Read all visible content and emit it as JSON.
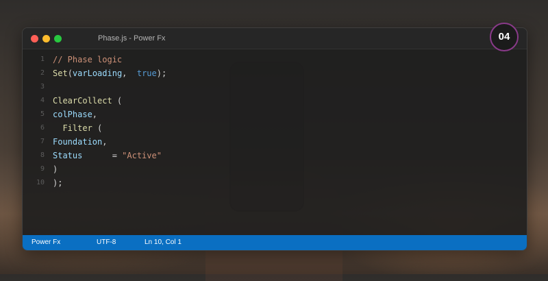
{
  "window": {
    "title": "Phase.js - Power Fx",
    "badge": "04"
  },
  "editor": {
    "lines": [
      {
        "n": "1",
        "tokens": [
          {
            "t": "// Phase logic",
            "c": "cmt"
          }
        ]
      },
      {
        "n": "2",
        "tokens": [
          {
            "t": "Set",
            "c": "fn"
          },
          {
            "t": "(",
            "c": "pun"
          },
          {
            "t": "varLoading",
            "c": "var"
          },
          {
            "t": ",  ",
            "c": "pun"
          },
          {
            "t": "true",
            "c": "kw"
          },
          {
            "t": ");",
            "c": "pun"
          }
        ]
      },
      {
        "n": "3",
        "tokens": []
      },
      {
        "n": "4",
        "tokens": [
          {
            "t": "ClearCollect",
            "c": "fn"
          },
          {
            "t": " (",
            "c": "pun"
          }
        ]
      },
      {
        "n": "5",
        "tokens": [
          {
            "t": "colPhase",
            "c": "var"
          },
          {
            "t": ",",
            "c": "pun"
          }
        ]
      },
      {
        "n": "6",
        "tokens": [
          {
            "t": "  Filter",
            "c": "fn"
          },
          {
            "t": " (",
            "c": "pun"
          }
        ]
      },
      {
        "n": "7",
        "tokens": [
          {
            "t": "Foundation",
            "c": "var"
          },
          {
            "t": ",",
            "c": "pun"
          }
        ]
      },
      {
        "n": "8",
        "tokens": [
          {
            "t": "Status",
            "c": "var"
          },
          {
            "t": "      = ",
            "c": "pun"
          },
          {
            "t": "\"Active\"",
            "c": "str"
          }
        ]
      },
      {
        "n": "9",
        "tokens": [
          {
            "t": ")",
            "c": "pun"
          }
        ]
      },
      {
        "n": "10",
        "tokens": [
          {
            "t": ");",
            "c": "pun"
          }
        ]
      }
    ]
  },
  "statusbar": {
    "language": "Power Fx",
    "encoding": "UTF-8",
    "position": "Ln 10, Col 1"
  },
  "colors": {
    "statusbar": "#0a6fc2",
    "badge_ring": "#8a3a8a",
    "function": "#dcdcaa",
    "variable": "#9cdcfe",
    "keyword": "#569cd6",
    "string": "#ce9178"
  }
}
